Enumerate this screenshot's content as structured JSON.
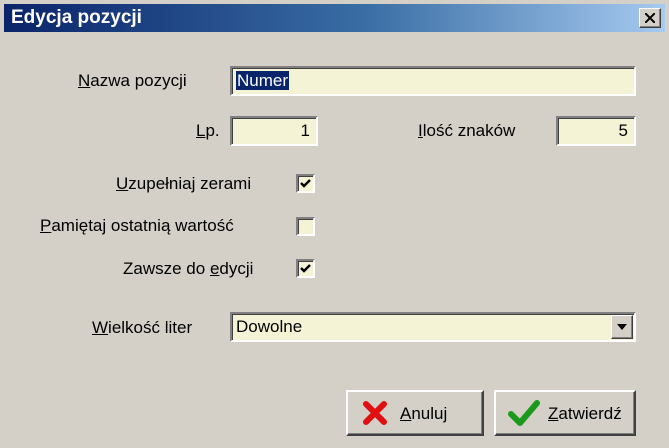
{
  "window": {
    "title": "Edycja pozycji",
    "close_glyph": "✕"
  },
  "form": {
    "name": {
      "label_ul": "N",
      "label_rest": "azwa pozycji",
      "value": "Numer"
    },
    "lp": {
      "label_ul": "L",
      "label_rest": "p.",
      "value": "1"
    },
    "chars": {
      "label_ul": "I",
      "label_rest": "lość znaków",
      "value": "5"
    },
    "fill_zeros": {
      "label_ul": "U",
      "label_rest": "zupełniaj zerami",
      "checked": true
    },
    "remember_last": {
      "label_ul": "P",
      "label_rest": "amiętaj ostatnią wartość",
      "checked": false
    },
    "always_edit": {
      "label_pre": "Zawsze do ",
      "label_ul": "e",
      "label_rest": "dycji",
      "checked": true
    },
    "letter_case": {
      "label_ul": "W",
      "label_rest": "ielkość liter",
      "value": "Dowolne"
    }
  },
  "buttons": {
    "cancel": {
      "label_ul": "A",
      "label_rest": "nuluj",
      "icon": "red-x-icon",
      "color": "#e01010"
    },
    "confirm": {
      "label_ul": "Z",
      "label_rest": "atwierdź",
      "icon": "green-check-icon",
      "color": "#1a9a1a"
    }
  },
  "colors": {
    "title_start": "#0a246a",
    "title_end": "#a6caf0",
    "field_bg": "#f5f3d6",
    "face": "#d4d0c8"
  }
}
